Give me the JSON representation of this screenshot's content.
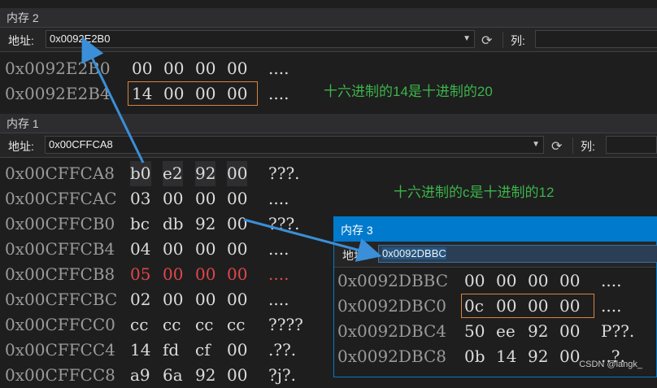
{
  "panels": {
    "mem2": {
      "title": "内存 2",
      "address_label": "地址:",
      "address_value": "0x0092E2B0",
      "col_label": "列:",
      "rows": [
        {
          "addr": "0x0092E2B0",
          "bytes": [
            "00",
            "00",
            "00",
            "00"
          ],
          "text": "...."
        },
        {
          "addr": "0x0092E2B4",
          "bytes": [
            "14",
            "00",
            "00",
            "00"
          ],
          "text": "...."
        }
      ]
    },
    "mem1": {
      "title": "内存 1",
      "address_label": "地址:",
      "address_value": "0x00CFFCA8",
      "col_label": "列:",
      "rows": [
        {
          "addr": "0x00CFFCA8",
          "bytes": [
            "b0",
            "e2",
            "92",
            "00"
          ],
          "text": "???."
        },
        {
          "addr": "0x00CFFCAC",
          "bytes": [
            "03",
            "00",
            "00",
            "00"
          ],
          "text": "...."
        },
        {
          "addr": "0x00CFFCB0",
          "bytes": [
            "bc",
            "db",
            "92",
            "00"
          ],
          "text": "???."
        },
        {
          "addr": "0x00CFFCB4",
          "bytes": [
            "04",
            "00",
            "00",
            "00"
          ],
          "text": "...."
        },
        {
          "addr": "0x00CFFCB8",
          "bytes": [
            "05",
            "00",
            "00",
            "00"
          ],
          "text": "...."
        },
        {
          "addr": "0x00CFFCBC",
          "bytes": [
            "02",
            "00",
            "00",
            "00"
          ],
          "text": "...."
        },
        {
          "addr": "0x00CFFCC0",
          "bytes": [
            "cc",
            "cc",
            "cc",
            "cc"
          ],
          "text": "????"
        },
        {
          "addr": "0x00CFFCC4",
          "bytes": [
            "14",
            "fd",
            "cf",
            "00"
          ],
          "text": ".??."
        },
        {
          "addr": "0x00CFFCC8",
          "bytes": [
            "a9",
            "6a",
            "92",
            "00"
          ],
          "text": "?j?."
        }
      ]
    },
    "mem3": {
      "title": "内存 3",
      "address_label": "地址:",
      "address_value": "0x0092DBBC",
      "rows": [
        {
          "addr": "0x0092DBBC",
          "bytes": [
            "00",
            "00",
            "00",
            "00"
          ],
          "text": "...."
        },
        {
          "addr": "0x0092DBC0",
          "bytes": [
            "0c",
            "00",
            "00",
            "00"
          ],
          "text": "...."
        },
        {
          "addr": "0x0092DBC4",
          "bytes": [
            "50",
            "ee",
            "92",
            "00"
          ],
          "text": "P??."
        },
        {
          "addr": "0x0092DBC8",
          "bytes": [
            "0b",
            "14",
            "92",
            "00"
          ],
          "text": "..?."
        }
      ]
    }
  },
  "annotations": {
    "note1": "十六进制的14是十进制的20",
    "note2": "十六进制的c是十进制的12"
  },
  "watermark": "CSDN @langk_",
  "colors": {
    "accent": "#007acc",
    "highlight_box": "#d7843f",
    "changed_value": "#e0464b",
    "annotation": "#3cb44b",
    "arrow": "#3a8fd8"
  }
}
